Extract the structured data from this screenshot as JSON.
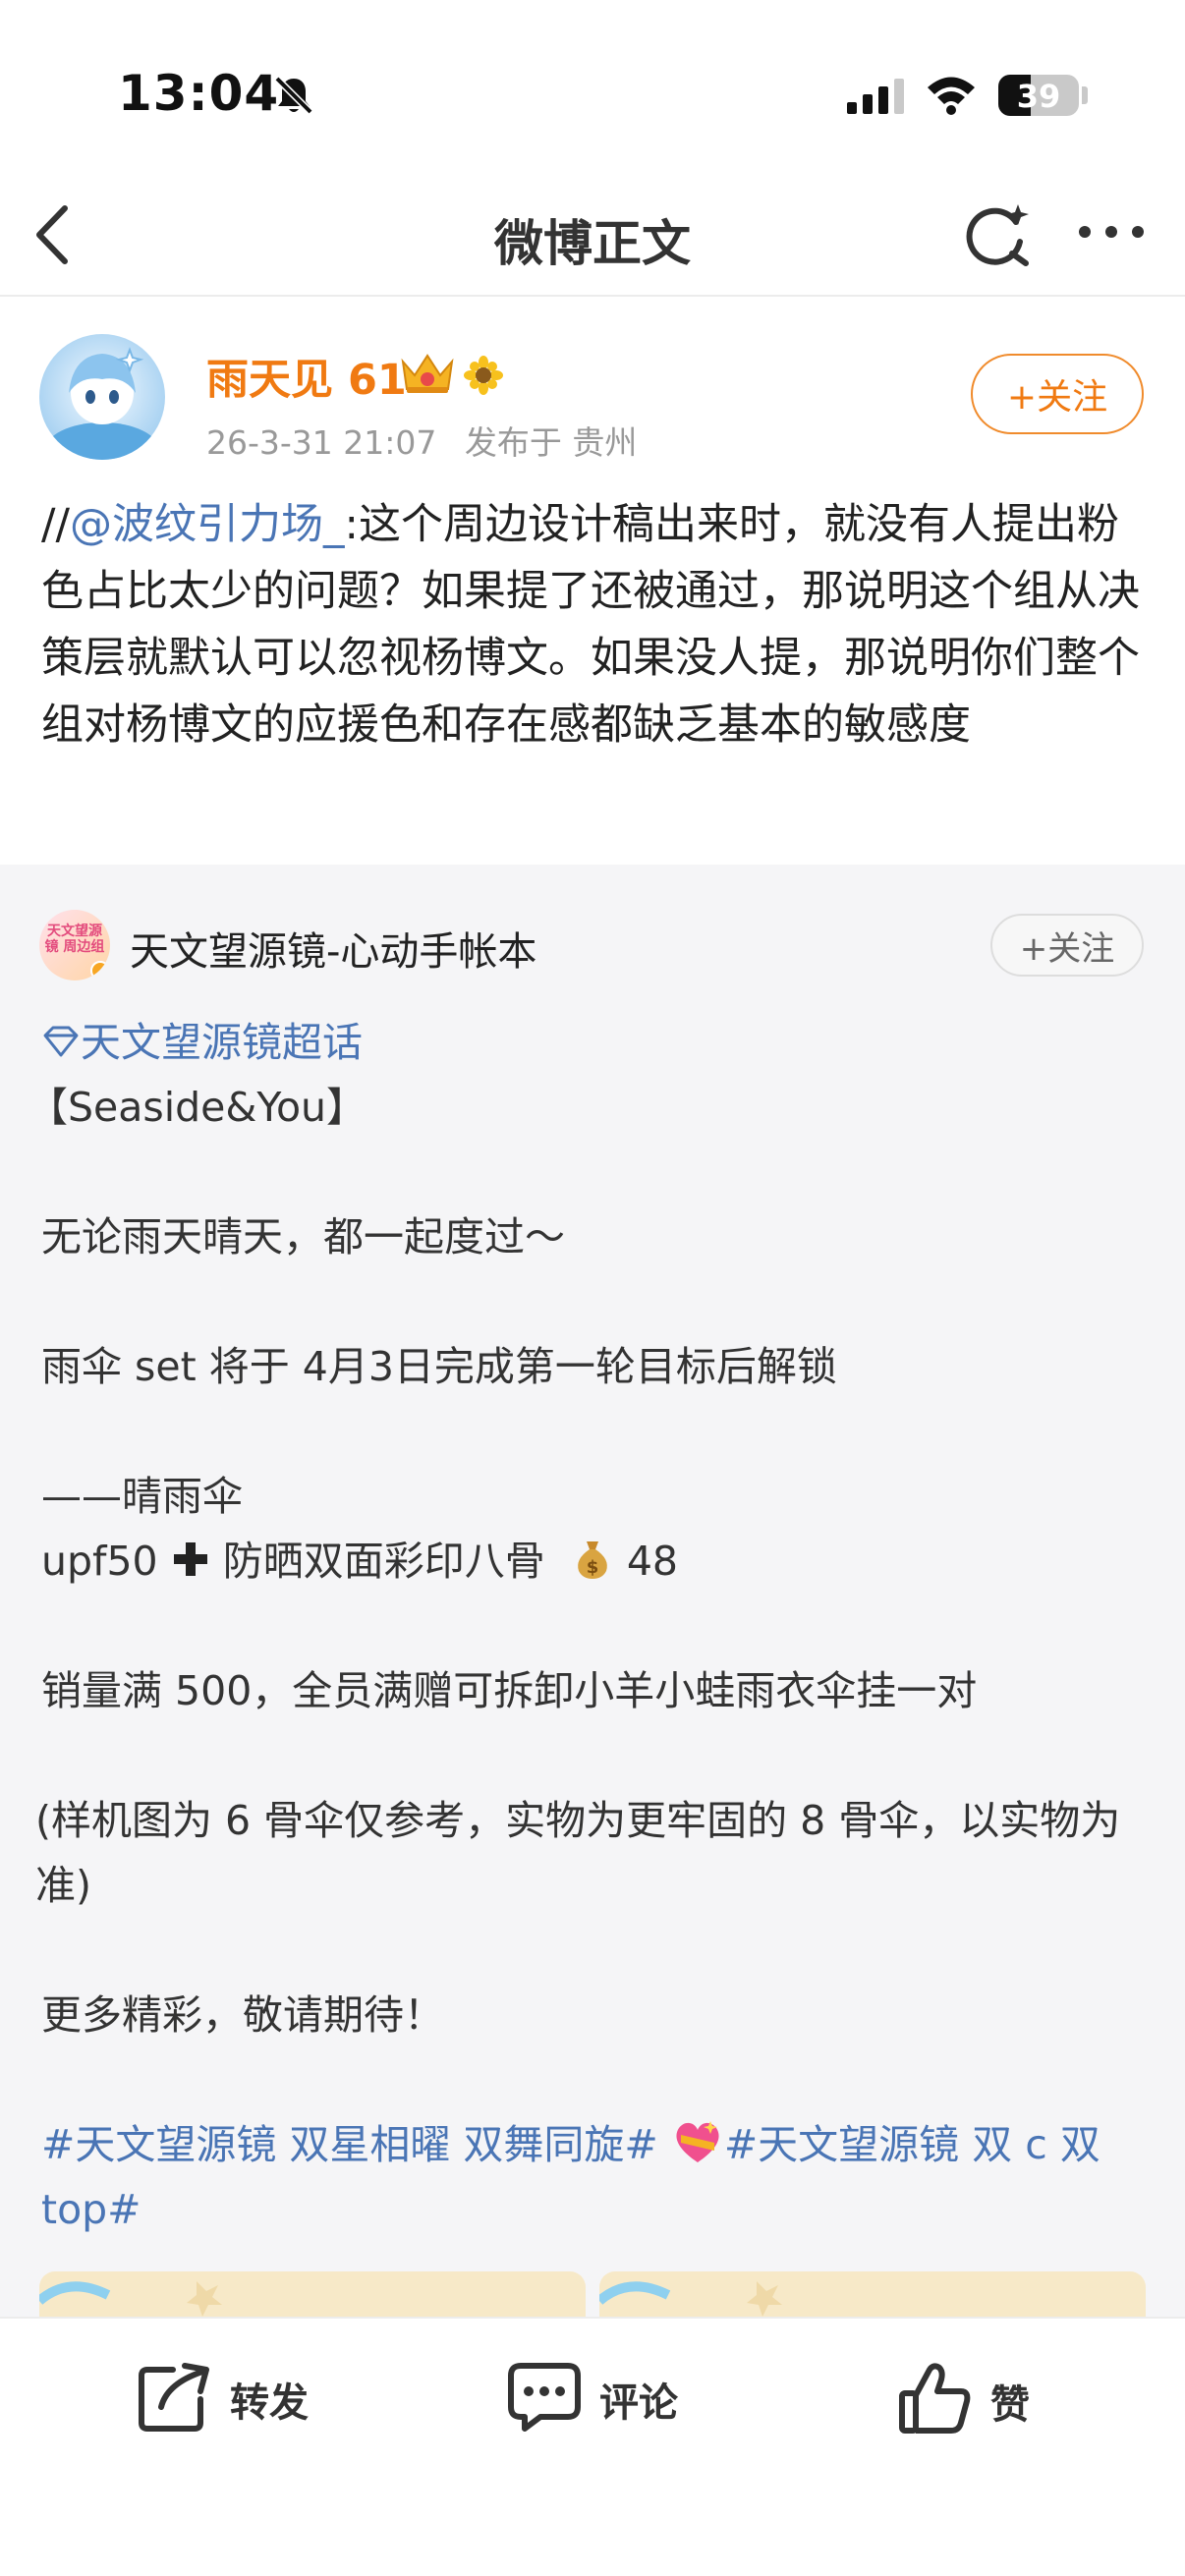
{
  "status_bar": {
    "time": "13:04",
    "battery": "39"
  },
  "nav": {
    "title": "微博正文"
  },
  "author": {
    "name": "雨天见 61",
    "date": "26-3-31 21:07",
    "location": "发布于 贵州",
    "follow_label": "+关注"
  },
  "repost": {
    "prefix": "//",
    "mention": "@波纹引力场_",
    "text": ":这个周边设计稿出来时，就没有人提出粉色占比太少的问题？如果提了还被通过，那说明这个组从决策层就默认可以忽视杨博文。如果没人提，那说明你们整个组对杨博文的应援色和存在感都缺乏基本的敏感度"
  },
  "original": {
    "account_name": "天文望源镜-心动手帐本",
    "avatar_text": "天文望源镜 周边组",
    "follow_label": "+关注",
    "supertopic": "天文望源镜超话",
    "title": "【Seaside&You】",
    "line1": "无论雨天晴天，都一起度过～",
    "line2": "雨伞 set 将于 4月3日完成第一轮目标后解锁",
    "line3": "——晴雨伞",
    "line4_a": "upf50",
    "line4_b": "防晒双面彩印八骨",
    "line4_c": "48",
    "line5": "销量满 500，全员满赠可拆卸小羊小蛙雨衣伞挂一对",
    "line6": "(样机图为 6 骨伞仅参考，实物为更牢固的 8 骨伞，以实物为准)",
    "line7": "更多精彩，敬请期待！",
    "hashtag1": "#天文望源镜 双星相曜 双舞同旋#",
    "hashtag2": "#天文望源镜 双 c 双 top#"
  },
  "actions": {
    "repost": "转发",
    "comment": "评论",
    "like": "赞"
  },
  "colors": {
    "accent_orange": "#f07a12",
    "link_blue": "#4a75b5"
  }
}
